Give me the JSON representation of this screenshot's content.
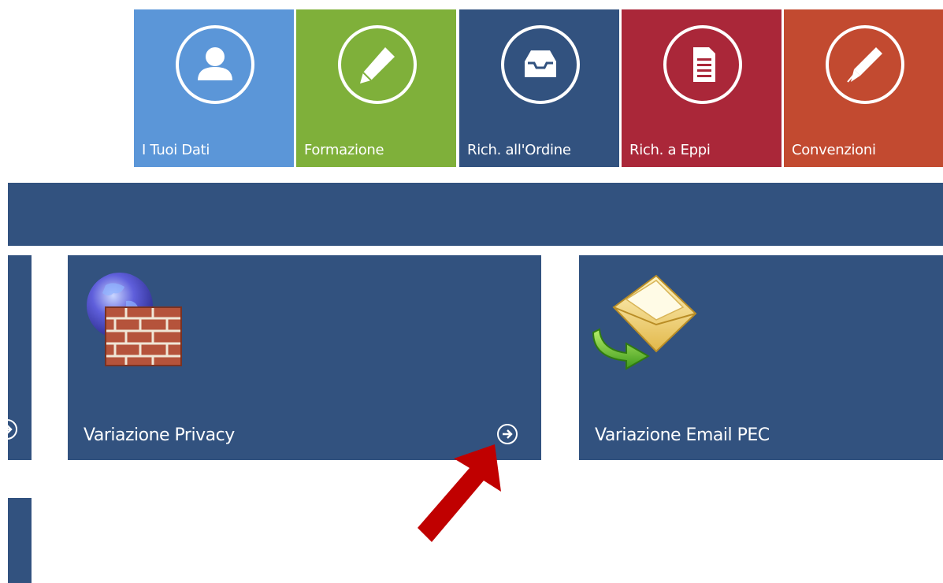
{
  "tiles": [
    {
      "label": "I Tuoi Dati",
      "icon": "user-icon",
      "color": "#5b96d8"
    },
    {
      "label": "Formazione",
      "icon": "pencil-icon",
      "color": "#7fb03a"
    },
    {
      "label": "Rich. all'Ordine",
      "icon": "inbox-icon",
      "color": "#32527f"
    },
    {
      "label": "Rich. a Eppi",
      "icon": "document-icon",
      "color": "#aa2739"
    },
    {
      "label": "Convenzioni",
      "icon": "pen-icon",
      "color": "#c24a30"
    }
  ],
  "cards": [
    {
      "label": "Variazione Privacy",
      "icon": "firewall-globe-icon",
      "action_icon": "arrow-right-circle-icon"
    },
    {
      "label": "Variazione Email PEC",
      "icon": "email-forward-icon"
    }
  ],
  "colors": {
    "panel": "#32527f",
    "annotation_arrow": "#c00000"
  }
}
